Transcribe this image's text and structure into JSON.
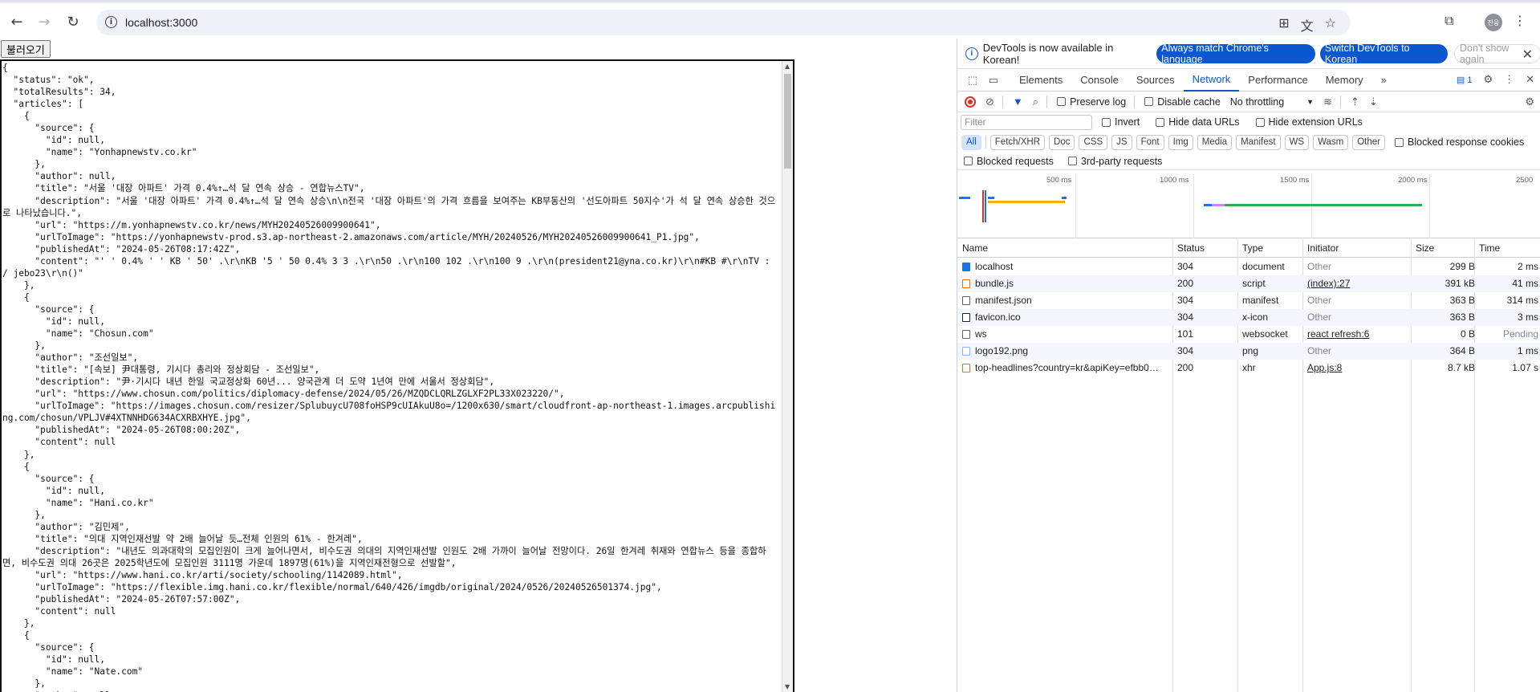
{
  "browser": {
    "url": "localhost:3000",
    "profile_initials": "진웅"
  },
  "page": {
    "load_button": "불러오기",
    "json_text": "{\n  \"status\": \"ok\",\n  \"totalResults\": 34,\n  \"articles\": [\n    {\n      \"source\": {\n        \"id\": null,\n        \"name\": \"Yonhapnewstv.co.kr\"\n      },\n      \"author\": null,\n      \"title\": \"서울 '대장 아파트' 가격 0.4%↑…석 달 연속 상승 - 연합뉴스TV\",\n      \"description\": \"서울 '대장 아파트' 가격 0.4%↑…석 달 연속 상승\\n\\n전국 '대장 아파트'의 가격 흐름을 보여주는 KB부동산의 '선도아파트 50지수'가 석 달 연속 상승한 것으로 나타났습니다.\",\n      \"url\": \"https://m.yonhapnewstv.co.kr/news/MYH20240526009900641\",\n      \"urlToImage\": \"https://yonhapnewstv-prod.s3.ap-northeast-2.amazonaws.com/article/MYH/20240526/MYH20240526009900641_P1.jpg\",\n      \"publishedAt\": \"2024-05-26T08:17:42Z\",\n      \"content\": \"' ' 0.4% ' ' KB ' 50' .\\r\\nKB '5 ' 50 0.4% 3 3 .\\r\\n50 .\\r\\n100 102 .\\r\\n100 9 .\\r\\n(president21@yna.co.kr)\\r\\n#KB #\\r\\nTV : / jebo23\\r\\n()\"\n    },\n    {\n      \"source\": {\n        \"id\": null,\n        \"name\": \"Chosun.com\"\n      },\n      \"author\": \"조선일보\",\n      \"title\": \"[속보] 尹대통령, 기시다 총리와 정상회담 - 조선일보\",\n      \"description\": \"尹·기시다 내년 한일 국교정상화 60년... 양국관계 더 도약 1년여 만에 서울서 정상회담\",\n      \"url\": \"https://www.chosun.com/politics/diplomacy-defense/2024/05/26/MZQDCLQRLZGLXF2PL33X023220/\",\n      \"urlToImage\": \"https://images.chosun.com/resizer/SplubuycU708foHSP9cUIAkuU8o=/1200x630/smart/cloudfront-ap-northeast-1.images.arcpublishing.com/chosun/VPLJV#4XTNNHDG634ACXRBXHYE.jpg\",\n      \"publishedAt\": \"2024-05-26T08:00:20Z\",\n      \"content\": null\n    },\n    {\n      \"source\": {\n        \"id\": null,\n        \"name\": \"Hani.co.kr\"\n      },\n      \"author\": \"김민제\",\n      \"title\": \"의대 지역인재선발 약 2배 늘어날 듯…전체 인원의 61% - 한겨레\",\n      \"description\": \"내년도 의과대학의 모집인원이 크게 늘어나면서, 비수도권 의대의 지역인재선발 인원도 2배 가까이 늘어날 전망이다. 26일 한겨레 취재와 연합뉴스 등을 종합하면, 비수도권 의대 26곳은 2025학년도에 모집인원 3111명 가운데 1897명(61%)을 지역인재전형으로 선발할\",\n      \"url\": \"https://www.hani.co.kr/arti/society/schooling/1142089.html\",\n      \"urlToImage\": \"https://flexible.img.hani.co.kr/flexible/normal/640/426/imgdb/original/2024/0526/20240526501374.jpg\",\n      \"publishedAt\": \"2024-05-26T07:57:00Z\",\n      \"content\": null\n    },\n    {\n      \"source\": {\n        \"id\": null,\n        \"name\": \"Nate.com\"\n      },\n      \"author\": null,"
  },
  "devtools": {
    "infobar": {
      "message": "DevTools is now available in Korean!",
      "btn_match": "Always match Chrome's language",
      "btn_switch": "Switch DevTools to Korean",
      "btn_dismiss": "Don't show again"
    },
    "tabs": [
      "Elements",
      "Console",
      "Sources",
      "Network",
      "Performance",
      "Memory"
    ],
    "issues_badge": "1",
    "toolbar": {
      "preserve_log": "Preserve log",
      "disable_cache": "Disable cache",
      "throttling": "No throttling"
    },
    "filter": {
      "placeholder": "Filter",
      "invert": "Invert",
      "hide_data_urls": "Hide data URLs",
      "hide_ext_urls": "Hide extension URLs"
    },
    "type_chips": [
      "All",
      "Fetch/XHR",
      "Doc",
      "CSS",
      "JS",
      "Font",
      "Img",
      "Media",
      "Manifest",
      "WS",
      "Wasm",
      "Other"
    ],
    "blocked_cookies": "Blocked response cookies",
    "blocked_requests": "Blocked requests",
    "third_party": "3rd-party requests",
    "overview_ticks": [
      "500 ms",
      "1000 ms",
      "1500 ms",
      "2000 ms",
      "2500"
    ],
    "columns": [
      "Name",
      "Status",
      "Type",
      "Initiator",
      "Size",
      "Time"
    ],
    "rows": [
      {
        "name": "localhost",
        "status": "304",
        "type": "document",
        "initiator": "Other",
        "size": "299 B",
        "time": "2 ms",
        "icon_color": "#1a73e8"
      },
      {
        "name": "bundle.js",
        "status": "200",
        "type": "script",
        "initiator": "(index):27",
        "size": "391 kB",
        "time": "41 ms",
        "icon_color": "#e8710a"
      },
      {
        "name": "manifest.json",
        "status": "304",
        "type": "manifest",
        "initiator": "Other",
        "size": "363 B",
        "time": "314 ms",
        "icon_color": "#5f6368"
      },
      {
        "name": "favicon.ico",
        "status": "304",
        "type": "x-icon",
        "initiator": "Other",
        "size": "363 B",
        "time": "3 ms",
        "icon_color": "#202124"
      },
      {
        "name": "ws",
        "status": "101",
        "type": "websocket",
        "initiator": "react refresh:6",
        "size": "0 B",
        "time": "Pending",
        "icon_color": "#5f6368"
      },
      {
        "name": "logo192.png",
        "status": "304",
        "type": "png",
        "initiator": "Other",
        "size": "364 B",
        "time": "1 ms",
        "icon_color": "#8ab4f8"
      },
      {
        "name": "top-headlines?country=kr&apiKey=efbb0…",
        "status": "200",
        "type": "xhr",
        "initiator": "App.js:8",
        "size": "8.7 kB",
        "time": "1.07 s",
        "icon_color": "#e8710a"
      }
    ]
  }
}
